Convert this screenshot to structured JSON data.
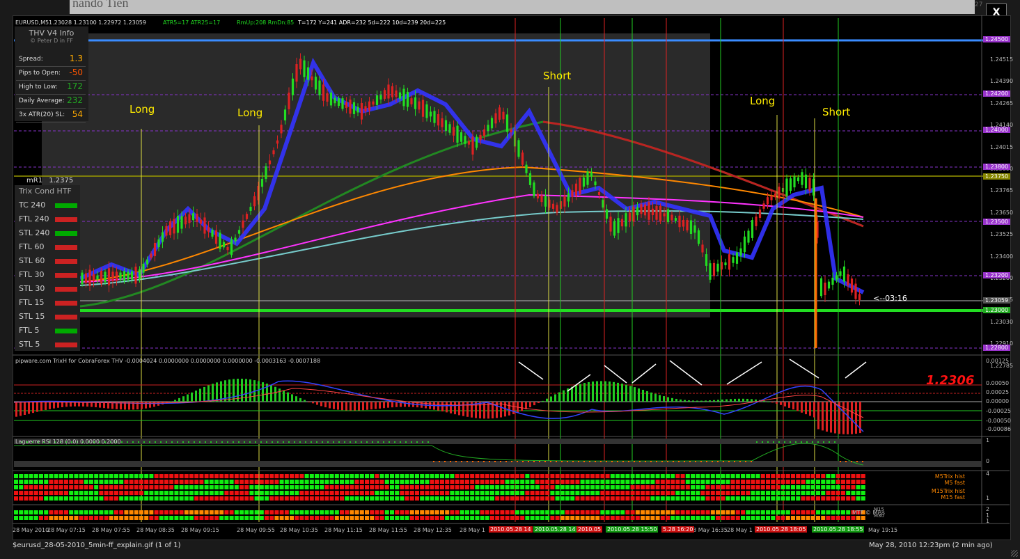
{
  "window": {
    "bg_title": "nando Tien",
    "close_label": "X",
    "corner_num": "27"
  },
  "header": {
    "symbol": "EURUSD,M5",
    "ohlc": "1.23028 1.23100 1.22972 1.23059",
    "atr": "ATR5=17 ATR25=17",
    "rm": "RmUp:208 RmDn:85",
    "stats": "T=172 Y=241 ADR=232 5d=222 10d=239 20d=225"
  },
  "info": {
    "title": "THV  V4 Info",
    "subtitle": "© Peter D in FF",
    "rows": [
      {
        "k": "Spread:",
        "v": "1.3",
        "c": "#ffaa00"
      },
      {
        "k": "Pips to Open:",
        "v": "-50",
        "c": "#ff5500"
      },
      {
        "k": "High to Low:",
        "v": "172",
        "c": "#22aa22"
      },
      {
        "k": "Daily Average:",
        "v": "232",
        "c": "#22aa22"
      },
      {
        "k": "3x ATR(20) SL:",
        "v": "54",
        "c": "#ffaa00"
      }
    ]
  },
  "mr1": {
    "label": "mR1",
    "value": "1.2375"
  },
  "trix_cond": {
    "title": "Trix Cond HTF",
    "rows": [
      {
        "k": "TC 240",
        "c": "#00aa00"
      },
      {
        "k": "FTL 240",
        "c": "#cc2222"
      },
      {
        "k": "STL 240",
        "c": "#00aa00"
      },
      {
        "k": "FTL 60",
        "c": "#cc2222"
      },
      {
        "k": "STL 60",
        "c": "#cc2222"
      },
      {
        "k": "FTL 30",
        "c": "#cc2222"
      },
      {
        "k": "STL 30",
        "c": "#cc2222"
      },
      {
        "k": "FTL 15",
        "c": "#cc2222"
      },
      {
        "k": "STL 15",
        "c": "#cc2222"
      },
      {
        "k": "FTL 5",
        "c": "#00aa00"
      },
      {
        "k": "STL 5",
        "c": "#cc2222"
      }
    ]
  },
  "annotations": {
    "long1": "Long",
    "long2": "Long",
    "short1": "Short",
    "long3": "Long",
    "short2": "Short",
    "timer": "<--03:16"
  },
  "price_axis": [
    "1.24515",
    "1.24390",
    "1.24265",
    "1.24140",
    "1.24015",
    "1.23890",
    "1.23765",
    "1.23650",
    "1.23525",
    "1.23400",
    "1.23280",
    "1.23155",
    "1.23030",
    "1.22910",
    "1.22785"
  ],
  "price_labels": [
    {
      "t": "1.24500",
      "c": "#9933cc"
    },
    {
      "t": "1.24200",
      "c": "#9933cc"
    },
    {
      "t": "1.24000",
      "c": "#9933cc"
    },
    {
      "t": "1.23800",
      "c": "#9933cc"
    },
    {
      "t": "1.23750",
      "c": "#888800"
    },
    {
      "t": "1.23500",
      "c": "#9933cc"
    },
    {
      "t": "1.23200",
      "c": "#9933cc"
    },
    {
      "t": "1.23059",
      "c": "#555555"
    },
    {
      "t": "1.23000",
      "c": "#22aa22"
    },
    {
      "t": "1.22800",
      "c": "#9933cc"
    }
  ],
  "trix": {
    "title": "pipware.com TrixH for CobraForex THV -0.0004024 0.0000000 0.0000000 0.0000000 -0.0003163 -0.0007188",
    "big_price": "1.2306",
    "axis": [
      "0.00125",
      "0.00050",
      "0.00025",
      "0.00000",
      "-0.00025",
      "-0.00050",
      "-0.00086"
    ]
  },
  "laguerre": {
    "title": "Laguerre RSI 128 (0.0) 0.0000 0.2000",
    "axis": [
      "1",
      "0"
    ]
  },
  "mtf": {
    "labels": [
      "M5Trix hist",
      "M5 fast",
      "M15Trix hist",
      "M15 fast"
    ],
    "axis": [
      "4",
      "1"
    ]
  },
  "mtf2": {
    "labels": [
      "M15",
      "M30"
    ],
    "credit": "MTF © Miss",
    "axis": [
      "2",
      "1",
      "1"
    ]
  },
  "xaxis": [
    "28 May 2010",
    "28 May 07:15",
    "28 May 07:55",
    "28 May 08:35",
    "28 May 09:15",
    "28 May 09:55",
    "28 May 10:35",
    "28 May 11:15",
    "28 May 11:55",
    "28 May 12:35",
    "28 May 1",
    "28 May 16:35",
    "28 May 1"
  ],
  "xaxis_hl": [
    {
      "t": "2010.05.28 14",
      "c": "#cc1111"
    },
    {
      "t": "2010.05.28 14",
      "c": "#119911"
    },
    {
      "t": "2010.05",
      "c": "#cc1111"
    },
    {
      "t": "2010.05.28 15:50",
      "c": "#119911"
    },
    {
      "t": "5.28 16:20",
      "c": "#cc1111"
    },
    {
      "t": "2010.05.28 18:05",
      "c": "#cc1111"
    },
    {
      "t": "2010.05.28 18:55",
      "c": "#119911"
    }
  ],
  "status": {
    "file": "$eurusd_28-05-2010_5min-ff_explain.gif (1 of 1)",
    "date": "May 28, 2010 12:23pm (2 min ago)",
    "last_tick": "May 19:15"
  }
}
